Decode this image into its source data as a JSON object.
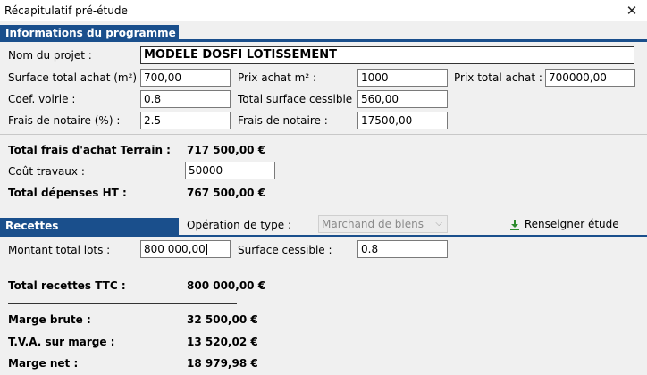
{
  "window": {
    "title": "Récapitulatif pré-étude",
    "close_glyph": "✕"
  },
  "programme": {
    "header": "Informations du programme",
    "nom_label": "Nom du projet :",
    "nom_value": "MODELE DOSFI LOTISSEMENT",
    "surface_achat_label": "Surface total achat (m²) :",
    "surface_achat_value": "700,00",
    "prix_m2_label": "Prix achat m² :",
    "prix_m2_value": "1000",
    "prix_total_label": "Prix total achat :",
    "prix_total_value": "700000,00",
    "coef_voirie_label": "Coef. voirie :",
    "coef_voirie_value": "0.8",
    "total_cessible_label": "Total surface cessible :",
    "total_cessible_value": "560,00",
    "frais_pct_label": "Frais de notaire (%) :",
    "frais_pct_value": "2.5",
    "frais_label": "Frais de notaire :",
    "frais_value": "17500,00"
  },
  "totaux": {
    "frais_achat_label": "Total frais d'achat Terrain :",
    "frais_achat_value": "717 500,00 €",
    "cout_travaux_label": "Coût travaux :",
    "cout_travaux_value": "50000",
    "depenses_label": "Total dépenses  HT :",
    "depenses_value": "767 500,00 €"
  },
  "recettes": {
    "header": "Recettes",
    "operation_label": "Opération de type :",
    "operation_value": "Marchand de biens",
    "renseigner_label": "Renseigner étude",
    "montant_label": "Montant total lots :",
    "montant_value": "800 000,00",
    "surface_label": "Surface cessible :",
    "surface_value": "0.8",
    "total_ttc_label": "Total recettes TTC :",
    "total_ttc_value": "800 000,00 €",
    "marge_brute_label": "Marge brute :",
    "marge_brute_value": "32 500,00 €",
    "tva_label": "T.V.A. sur marge :",
    "tva_value": "13 520,02 €",
    "marge_net_label": "Marge net :",
    "marge_net_value": "18 979,98 €"
  },
  "colors": {
    "accent": "#1a4f8c",
    "background": "#f0f0f0",
    "download_icon": "#2e8b2e"
  }
}
